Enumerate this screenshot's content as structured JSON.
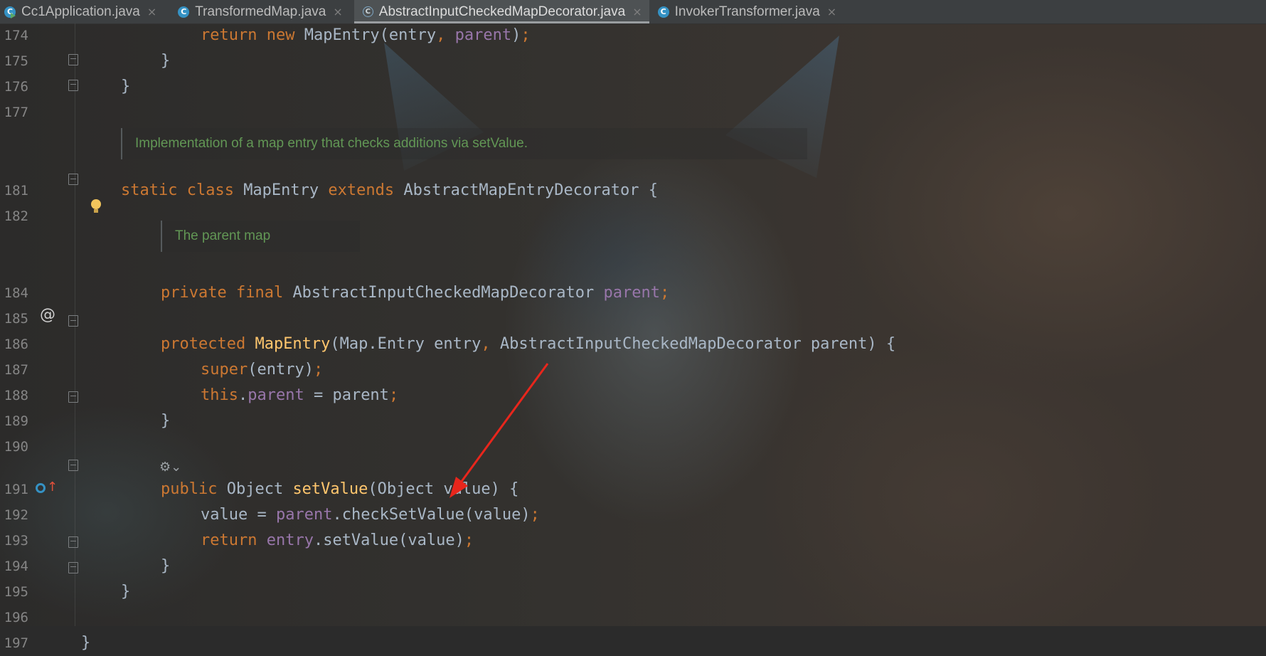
{
  "tabs": [
    {
      "label": "Cc1Application.java",
      "icon": "java-class-run-icon",
      "active": false
    },
    {
      "label": "TransformedMap.java",
      "icon": "java-class-icon",
      "active": false
    },
    {
      "label": "AbstractInputCheckedMapDecorator.java",
      "icon": "abstract-class-icon",
      "active": true
    },
    {
      "label": "InvokerTransformer.java",
      "icon": "java-class-icon",
      "active": false
    }
  ],
  "tab_icon_letter": "C",
  "close_glyph": "×",
  "lines": {
    "l174": "174",
    "l175": "175",
    "l176": "176",
    "l177": "177",
    "l181": "181",
    "l182": "182",
    "l184": "184",
    "l185": "185",
    "l186": "186",
    "l187": "187",
    "l188": "188",
    "l189": "189",
    "l190": "190",
    "l191": "191",
    "l192": "192",
    "l193": "193",
    "l194": "194",
    "l195": "195",
    "l196": "196",
    "l197": "197"
  },
  "docs": {
    "map_entry": "Implementation of a map entry that checks additions via setValue.",
    "parent_map": "The parent map"
  },
  "gutter": {
    "implements_marker": "@"
  },
  "colors": {
    "keyword": "#cc7832",
    "method": "#ffc66d",
    "field": "#9876aa",
    "plain": "#a9b7c6",
    "doc": "#629755",
    "annotation_arrow": "#e8261c"
  }
}
